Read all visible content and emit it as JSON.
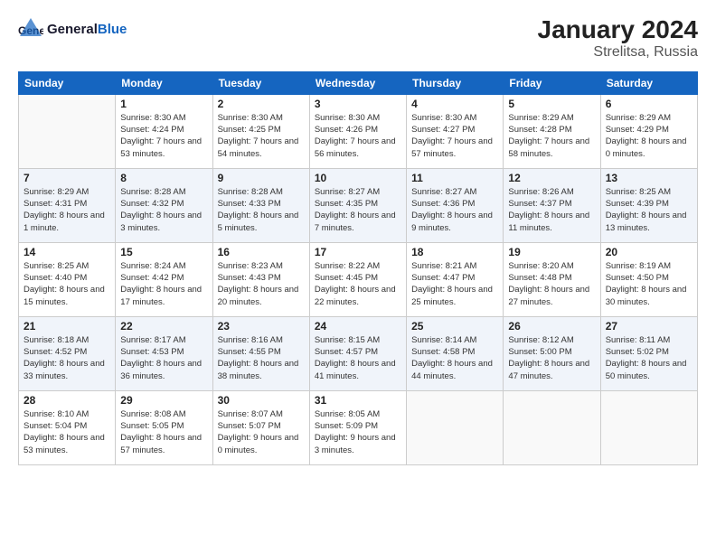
{
  "header": {
    "logo_general": "General",
    "logo_blue": "Blue",
    "title": "January 2024",
    "subtitle": "Strelitsa, Russia"
  },
  "days_of_week": [
    "Sunday",
    "Monday",
    "Tuesday",
    "Wednesday",
    "Thursday",
    "Friday",
    "Saturday"
  ],
  "weeks": [
    [
      {
        "day": null
      },
      {
        "day": 1,
        "sunrise": "8:30 AM",
        "sunset": "4:24 PM",
        "daylight": "7 hours and 53 minutes."
      },
      {
        "day": 2,
        "sunrise": "8:30 AM",
        "sunset": "4:25 PM",
        "daylight": "7 hours and 54 minutes."
      },
      {
        "day": 3,
        "sunrise": "8:30 AM",
        "sunset": "4:26 PM",
        "daylight": "7 hours and 56 minutes."
      },
      {
        "day": 4,
        "sunrise": "8:30 AM",
        "sunset": "4:27 PM",
        "daylight": "7 hours and 57 minutes."
      },
      {
        "day": 5,
        "sunrise": "8:29 AM",
        "sunset": "4:28 PM",
        "daylight": "7 hours and 58 minutes."
      },
      {
        "day": 6,
        "sunrise": "8:29 AM",
        "sunset": "4:29 PM",
        "daylight": "8 hours and 0 minutes."
      }
    ],
    [
      {
        "day": 7,
        "sunrise": "8:29 AM",
        "sunset": "4:31 PM",
        "daylight": "8 hours and 1 minute."
      },
      {
        "day": 8,
        "sunrise": "8:28 AM",
        "sunset": "4:32 PM",
        "daylight": "8 hours and 3 minutes."
      },
      {
        "day": 9,
        "sunrise": "8:28 AM",
        "sunset": "4:33 PM",
        "daylight": "8 hours and 5 minutes."
      },
      {
        "day": 10,
        "sunrise": "8:27 AM",
        "sunset": "4:35 PM",
        "daylight": "8 hours and 7 minutes."
      },
      {
        "day": 11,
        "sunrise": "8:27 AM",
        "sunset": "4:36 PM",
        "daylight": "8 hours and 9 minutes."
      },
      {
        "day": 12,
        "sunrise": "8:26 AM",
        "sunset": "4:37 PM",
        "daylight": "8 hours and 11 minutes."
      },
      {
        "day": 13,
        "sunrise": "8:25 AM",
        "sunset": "4:39 PM",
        "daylight": "8 hours and 13 minutes."
      }
    ],
    [
      {
        "day": 14,
        "sunrise": "8:25 AM",
        "sunset": "4:40 PM",
        "daylight": "8 hours and 15 minutes."
      },
      {
        "day": 15,
        "sunrise": "8:24 AM",
        "sunset": "4:42 PM",
        "daylight": "8 hours and 17 minutes."
      },
      {
        "day": 16,
        "sunrise": "8:23 AM",
        "sunset": "4:43 PM",
        "daylight": "8 hours and 20 minutes."
      },
      {
        "day": 17,
        "sunrise": "8:22 AM",
        "sunset": "4:45 PM",
        "daylight": "8 hours and 22 minutes."
      },
      {
        "day": 18,
        "sunrise": "8:21 AM",
        "sunset": "4:47 PM",
        "daylight": "8 hours and 25 minutes."
      },
      {
        "day": 19,
        "sunrise": "8:20 AM",
        "sunset": "4:48 PM",
        "daylight": "8 hours and 27 minutes."
      },
      {
        "day": 20,
        "sunrise": "8:19 AM",
        "sunset": "4:50 PM",
        "daylight": "8 hours and 30 minutes."
      }
    ],
    [
      {
        "day": 21,
        "sunrise": "8:18 AM",
        "sunset": "4:52 PM",
        "daylight": "8 hours and 33 minutes."
      },
      {
        "day": 22,
        "sunrise": "8:17 AM",
        "sunset": "4:53 PM",
        "daylight": "8 hours and 36 minutes."
      },
      {
        "day": 23,
        "sunrise": "8:16 AM",
        "sunset": "4:55 PM",
        "daylight": "8 hours and 38 minutes."
      },
      {
        "day": 24,
        "sunrise": "8:15 AM",
        "sunset": "4:57 PM",
        "daylight": "8 hours and 41 minutes."
      },
      {
        "day": 25,
        "sunrise": "8:14 AM",
        "sunset": "4:58 PM",
        "daylight": "8 hours and 44 minutes."
      },
      {
        "day": 26,
        "sunrise": "8:12 AM",
        "sunset": "5:00 PM",
        "daylight": "8 hours and 47 minutes."
      },
      {
        "day": 27,
        "sunrise": "8:11 AM",
        "sunset": "5:02 PM",
        "daylight": "8 hours and 50 minutes."
      }
    ],
    [
      {
        "day": 28,
        "sunrise": "8:10 AM",
        "sunset": "5:04 PM",
        "daylight": "8 hours and 53 minutes."
      },
      {
        "day": 29,
        "sunrise": "8:08 AM",
        "sunset": "5:05 PM",
        "daylight": "8 hours and 57 minutes."
      },
      {
        "day": 30,
        "sunrise": "8:07 AM",
        "sunset": "5:07 PM",
        "daylight": "9 hours and 0 minutes."
      },
      {
        "day": 31,
        "sunrise": "8:05 AM",
        "sunset": "5:09 PM",
        "daylight": "9 hours and 3 minutes."
      },
      {
        "day": null
      },
      {
        "day": null
      },
      {
        "day": null
      }
    ]
  ]
}
